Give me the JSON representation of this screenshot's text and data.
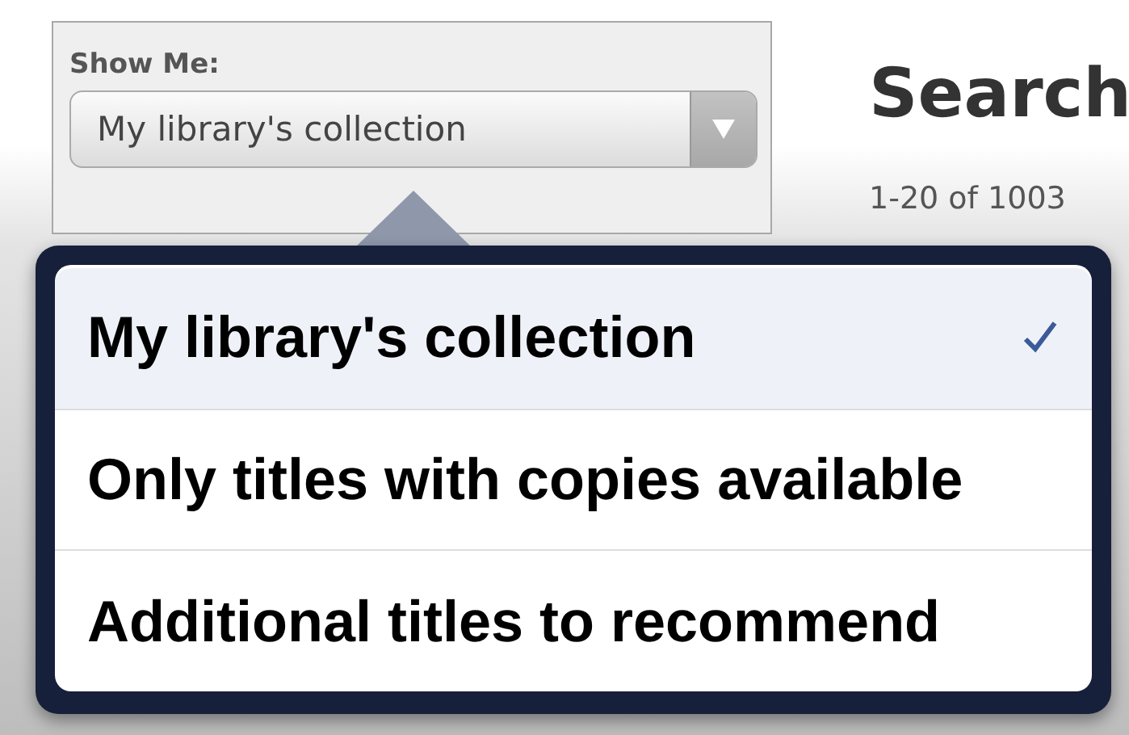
{
  "filter": {
    "label": "Show Me:",
    "value": "My library's collection"
  },
  "results": {
    "title": "Search",
    "count": "1-20 of 1003"
  },
  "menu": {
    "items": [
      {
        "label": "My library's collection",
        "selected": true
      },
      {
        "label": "Only titles with copies available",
        "selected": false
      },
      {
        "label": "Additional titles to recommend",
        "selected": false
      }
    ]
  }
}
